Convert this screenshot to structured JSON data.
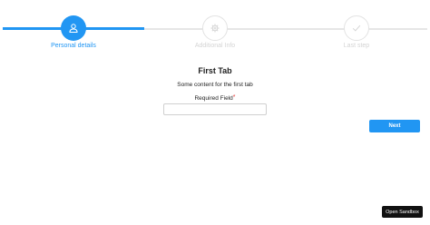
{
  "colors": {
    "accent": "#2196f3",
    "idle": "#d4d4d4",
    "required": "#e53935",
    "sandbox": "#111111"
  },
  "steps": [
    {
      "label": "Personal details",
      "icon": "user-icon",
      "state": "active"
    },
    {
      "label": "Additional Info",
      "icon": "gear-icon",
      "state": "idle"
    },
    {
      "label": "Last step",
      "icon": "check-icon",
      "state": "idle"
    }
  ],
  "content": {
    "title": "First Tab",
    "body": "Some content for the first tab",
    "field": {
      "label": "Required Field",
      "required_marker": "*",
      "value": "",
      "placeholder": ""
    }
  },
  "actions": {
    "next_label": "Next",
    "sandbox_label": "Open Sandbox"
  }
}
